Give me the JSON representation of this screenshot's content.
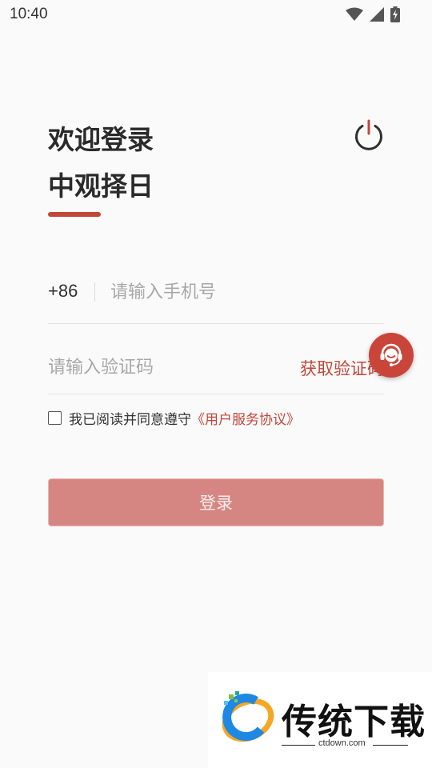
{
  "status_bar": {
    "time": "10:40",
    "icons": [
      "wifi-icon",
      "cellular-signal-icon",
      "battery-charging-icon"
    ]
  },
  "header": {
    "welcome": "欢迎登录",
    "app_name": "中观择日",
    "power_icon": "power-icon"
  },
  "phone": {
    "country_code": "+86",
    "placeholder": "请输入手机号",
    "value": ""
  },
  "verify": {
    "placeholder": "请输入验证码",
    "value": "",
    "get_code_label": "获取验证码"
  },
  "support": {
    "icon": "customer-service-icon"
  },
  "agreement": {
    "checked": false,
    "text": "我已阅读并同意遵守",
    "link": "《用户服务协议》"
  },
  "login": {
    "label": "登录"
  },
  "watermark": {
    "title": "传统下载",
    "domain": "ctdown.com"
  },
  "colors": {
    "accent": "#c0473a",
    "login_button": "#d68682",
    "background": "#fafafa"
  }
}
